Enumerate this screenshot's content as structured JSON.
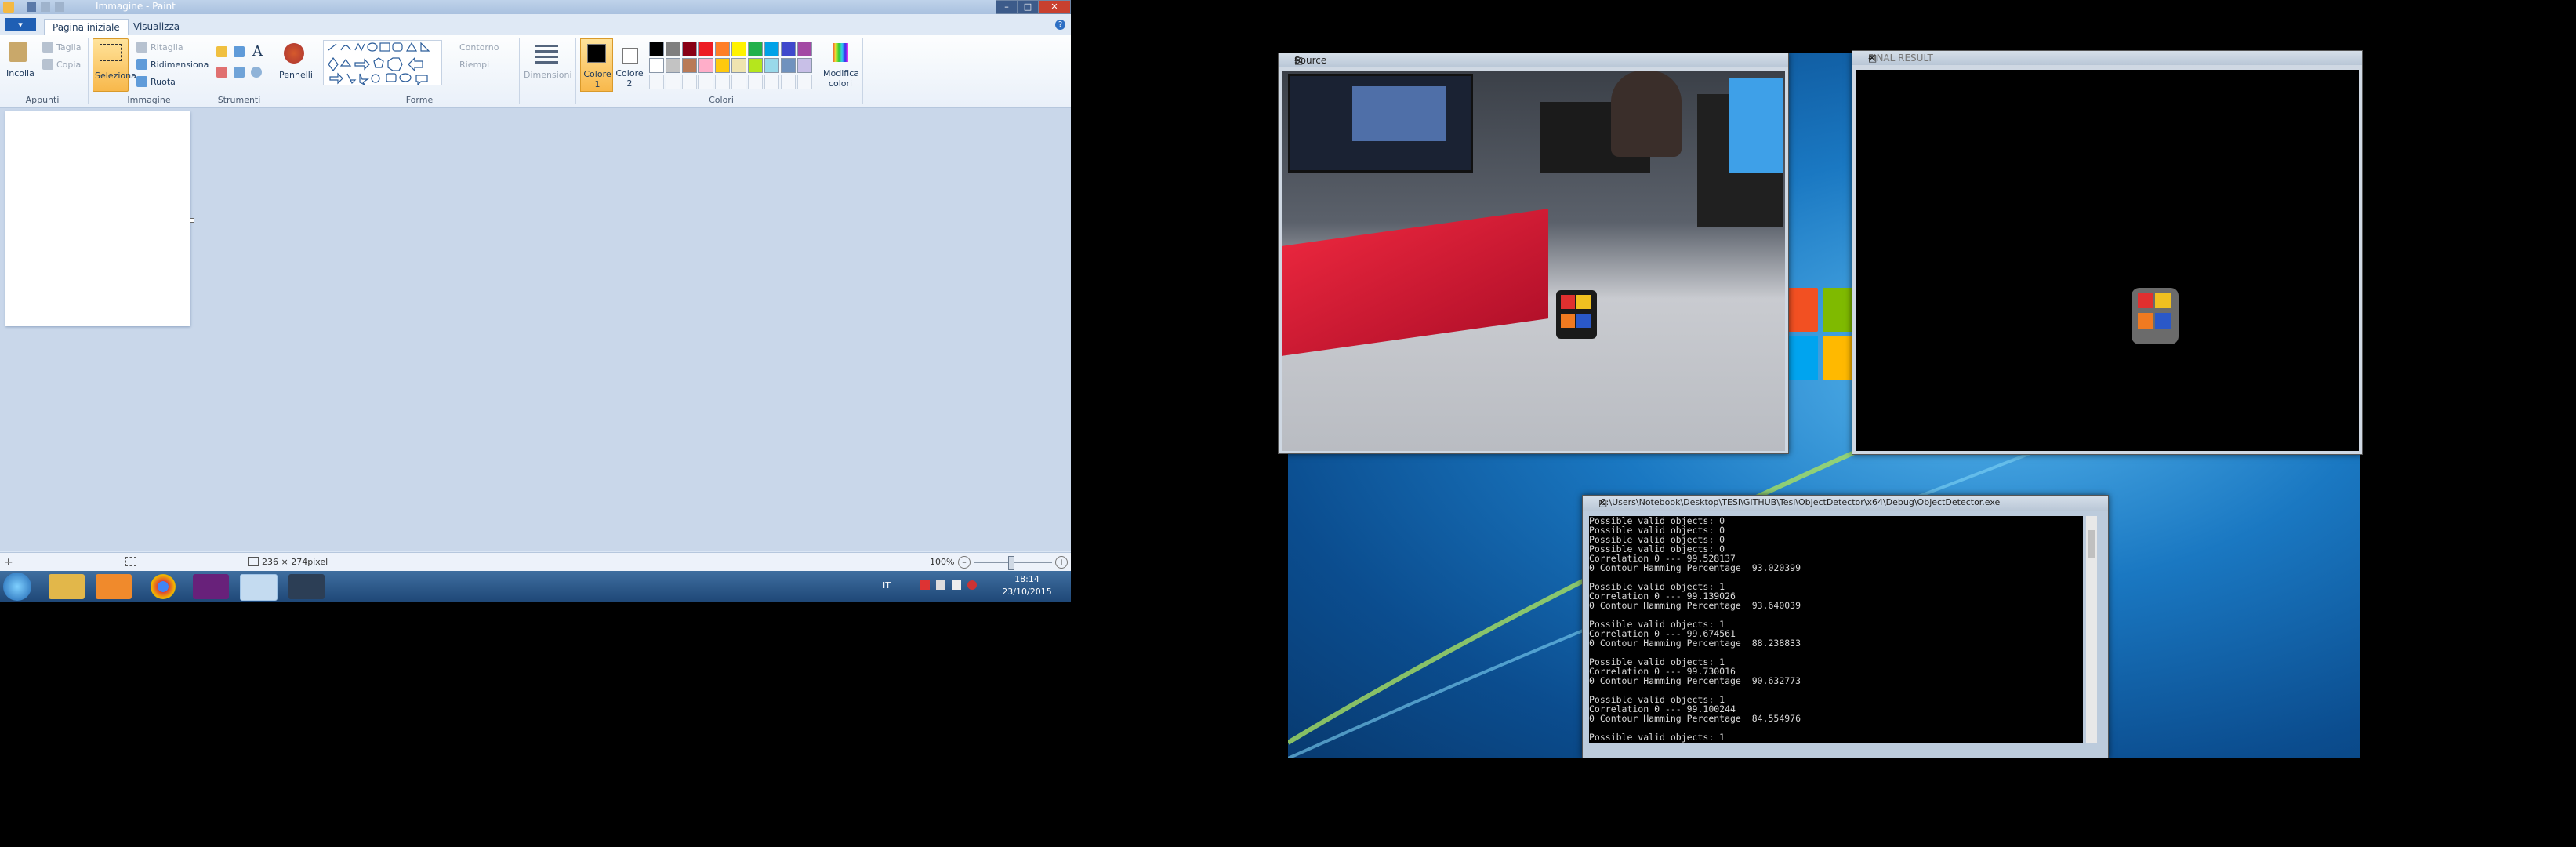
{
  "paint": {
    "title": "Immagine - Paint",
    "file_menu": "▾",
    "tabs": [
      "Pagina iniziale",
      "Visualizza"
    ],
    "clipboard": {
      "paste": "Incolla",
      "cut": "Taglia",
      "copy": "Copia",
      "group": "Appunti"
    },
    "image": {
      "select": "Seleziona",
      "crop": "Ritaglia",
      "resize": "Ridimensiona",
      "rotate": "Ruota",
      "group": "Immagine"
    },
    "tools": {
      "group": "Strumenti",
      "brushes": "Pennelli"
    },
    "shapes": {
      "outline": "Contorno",
      "fill": "Riempi",
      "group": "Forme"
    },
    "size": {
      "label": "Dimensioni"
    },
    "colors": {
      "color1": "Colore 1",
      "color2": "Colore 2",
      "edit": "Modifica colori",
      "group": "Colori",
      "palette_row1": [
        "#000000",
        "#7f7f7f",
        "#880015",
        "#ed1c24",
        "#ff7f27",
        "#fff200",
        "#22b14c",
        "#00a2e8",
        "#3f48cc",
        "#a349a4"
      ],
      "palette_row2": [
        "#ffffff",
        "#c3c3c3",
        "#b97a57",
        "#ffaec9",
        "#ffc90e",
        "#efe4b0",
        "#b5e61d",
        "#99d9ea",
        "#7092be",
        "#c8bfe7"
      ]
    },
    "status": {
      "size": "236 × 274pixel",
      "zoom": "100%"
    },
    "taskbar": {
      "lang": "IT",
      "time": "18:14",
      "date": "23/10/2015"
    }
  },
  "windows": {
    "source": {
      "title": "Source"
    },
    "final": {
      "title": "FINAL RESULT"
    },
    "console": {
      "title": "C:\\Users\\Notebook\\Desktop\\TESI\\GITHUB\\Tesi\\ObjectDetector\\x64\\Debug\\ObjectDetector.exe",
      "lines": [
        "Possible valid objects: 0",
        "Possible valid objects: 0",
        "Possible valid objects: 0",
        "Possible valid objects: 0",
        "Correlation 0 --- 99.528137",
        "0 Contour Hamming Percentage  93.020399",
        "",
        "Possible valid objects: 1",
        "Correlation 0 --- 99.139026",
        "0 Contour Hamming Percentage  93.640039",
        "",
        "Possible valid objects: 1",
        "Correlation 0 --- 99.674561",
        "0 Contour Hamming Percentage  88.238833",
        "",
        "Possible valid objects: 1",
        "Correlation 0 --- 99.730016",
        "0 Contour Hamming Percentage  90.632773",
        "",
        "Possible valid objects: 1",
        "Correlation 0 --- 99.100244",
        "0 Contour Hamming Percentage  84.554976",
        "",
        "Possible valid objects: 1"
      ]
    }
  }
}
